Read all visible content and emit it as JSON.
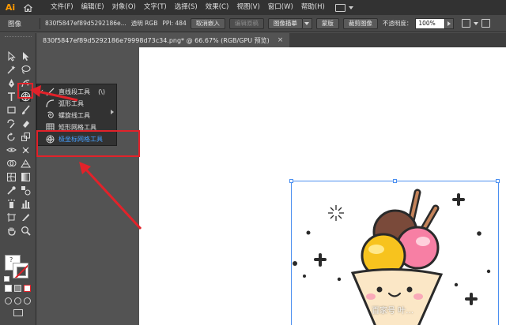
{
  "app": {
    "logo": "Ai",
    "menu": [
      "文件(F)",
      "编辑(E)",
      "对象(O)",
      "文字(T)",
      "选择(S)",
      "效果(C)",
      "视图(V)",
      "窗口(W)",
      "帮助(H)"
    ]
  },
  "control_bar": {
    "label": "图像",
    "filename": "830f5847ef89d5292186e...",
    "info_mode": "透明 RGB",
    "info_ppi": "PPI: 484",
    "unembed_label": "取消嵌入",
    "edit_original_label": "编辑原稿",
    "image_trace_label": "图像描摹",
    "mask_label": "蒙版",
    "crop_label": "裁剪图像",
    "opacity_label": "不透明度：",
    "opacity_value": "100%"
  },
  "document_tab": {
    "title": "830f5847ef89d5292186e79998d73c34.png* @ 66.67% (RGB/GPU 预览)",
    "close": "×"
  },
  "flyout": {
    "items": [
      {
        "label": "直线段工具",
        "shortcut": "(\\)",
        "icon": "line-segment-icon",
        "current": true
      },
      {
        "label": "弧形工具",
        "icon": "arc-icon"
      },
      {
        "label": "螺旋线工具",
        "icon": "spiral-icon"
      },
      {
        "label": "矩形网格工具",
        "icon": "rectangular-grid-icon"
      },
      {
        "label": "极坐标网格工具",
        "icon": "polar-grid-icon",
        "highlighted": true
      }
    ],
    "check_mark": "✓"
  },
  "toolbar": {
    "swatch_help": "?",
    "more_tools": "···"
  },
  "watermark": "百家号 叶…",
  "colors": {
    "annotation_red": "#e2222a",
    "selection_blue": "#4b8ff0",
    "highlight_blue": "#46a0ff",
    "logo_orange": "#ff9a00"
  }
}
